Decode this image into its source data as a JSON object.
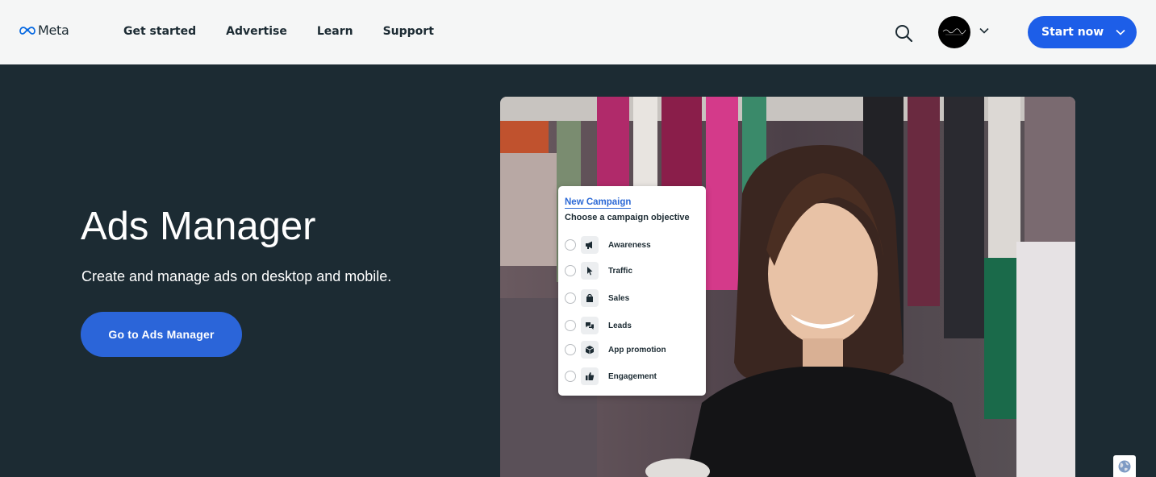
{
  "header": {
    "logo_text": "Meta",
    "nav": [
      {
        "label": "Get started"
      },
      {
        "label": "Advertise"
      },
      {
        "label": "Learn"
      },
      {
        "label": "Support"
      }
    ],
    "search_icon": "search-icon",
    "start_button_label": "Start now"
  },
  "hero": {
    "title": "Ads Manager",
    "subtitle": "Create and manage ads on desktop and mobile.",
    "cta_label": "Go to Ads Manager"
  },
  "campaign_card": {
    "title": "New Campaign",
    "subtitle": "Choose a campaign objective",
    "options": [
      {
        "label": "Awareness",
        "icon": "megaphone-icon"
      },
      {
        "label": "Traffic",
        "icon": "cursor-icon"
      },
      {
        "label": "Sales",
        "icon": "shopping-bag-icon"
      },
      {
        "label": "Leads",
        "icon": "chat-bubbles-icon"
      },
      {
        "label": "App promotion",
        "icon": "box-icon"
      },
      {
        "label": "Engagement",
        "icon": "thumbs-up-icon"
      }
    ]
  },
  "colors": {
    "header_bg": "#f5f6f6",
    "hero_bg": "#1c2b33",
    "accent_blue": "#1d5ee8",
    "cta_blue": "#2b65d9",
    "card_link_blue": "#2d6ad6"
  }
}
